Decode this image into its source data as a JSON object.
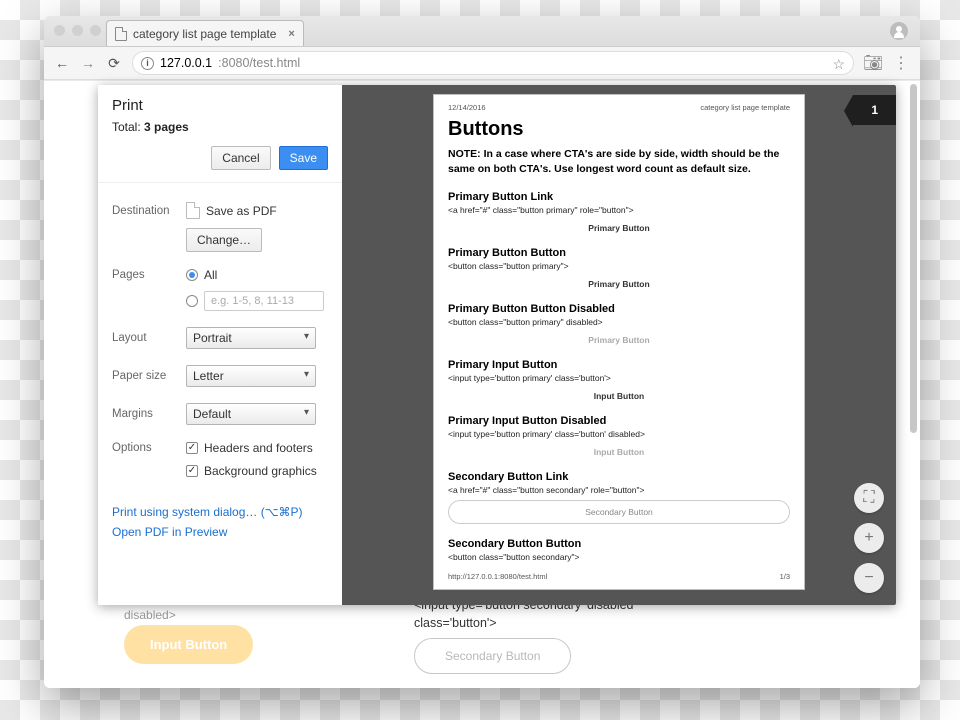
{
  "browser": {
    "tab_title": "category list page template",
    "url_host": "127.0.0.1",
    "url_port_path": ":8080/test.html"
  },
  "bg": {
    "disabled_text": "disabled>",
    "input_btn": "Input Button",
    "sec_code_l1": "<input type='button secondary' disabled",
    "sec_code_l2": "class='button'>",
    "sec_btn": "Secondary Button"
  },
  "print": {
    "title": "Print",
    "total_prefix": "Total: ",
    "total_value": "3 pages",
    "cancel": "Cancel",
    "save": "Save",
    "dest_label": "Destination",
    "dest_value": "Save as PDF",
    "change_btn": "Change…",
    "pages_label": "Pages",
    "pages_all": "All",
    "pages_placeholder": "e.g. 1-5, 8, 11-13",
    "layout_label": "Layout",
    "layout_value": "Portrait",
    "paper_label": "Paper size",
    "paper_value": "Letter",
    "margins_label": "Margins",
    "margins_value": "Default",
    "options_label": "Options",
    "opt_headers": "Headers and footers",
    "opt_bg": "Background graphics",
    "link_sys": "Print using system dialog… (⌥⌘P)",
    "link_preview": "Open PDF in Preview",
    "page_badge": "1"
  },
  "preview": {
    "date": "12/14/2016",
    "header_title": "category list page template",
    "h1": "Buttons",
    "note": "NOTE: In a case where CTA's are side by side, width should be the same on both CTA's. Use longest word count as default size.",
    "sections": [
      {
        "title": "Primary Button Link",
        "code": "<a href=\"#\" class=\"button primary\" role=\"button\">",
        "label": "Primary Button"
      },
      {
        "title": "Primary Button Button",
        "code": "<button class=\"button primary\">",
        "label": "Primary Button"
      },
      {
        "title": "Primary Button Button Disabled",
        "code": "<button class=\"button primary\" disabled>",
        "label": "Primary Button"
      },
      {
        "title": "Primary Input Button",
        "code": "<input type='button primary' class='button'>",
        "label": "Input Button"
      },
      {
        "title": "Primary Input Button Disabled",
        "code": "<input type='button primary' class='button' disabled>",
        "label": "Input Button"
      },
      {
        "title": "Secondary Button Link",
        "code": "<a href=\"#\" class=\"button secondary\" role=\"button\">",
        "label": "Secondary Button",
        "outline": true
      },
      {
        "title": "Secondary Button Button",
        "code": "<button class=\"button secondary\">",
        "label": ""
      }
    ],
    "footer_url": "http://127.0.0.1:8080/test.html",
    "footer_page": "1/3"
  }
}
